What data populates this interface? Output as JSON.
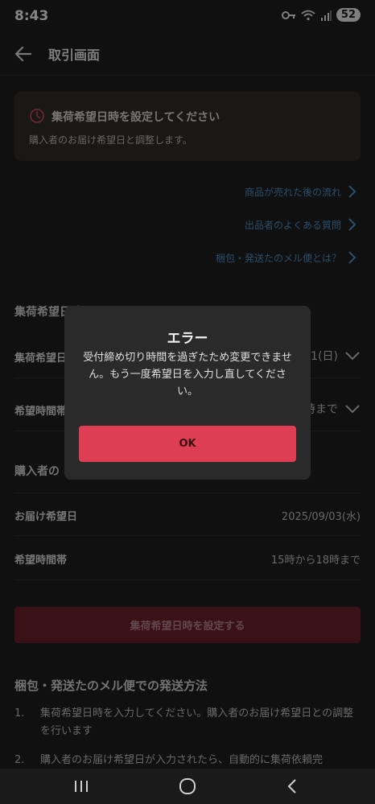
{
  "status_bar": {
    "time": "8:43",
    "battery": "52"
  },
  "header": {
    "title": "取引画面"
  },
  "notice": {
    "title": "集荷希望日時を設定してください",
    "subtitle": "購入者のお届け希望日と調整します。"
  },
  "help_links": [
    {
      "label": "商品が売れた後の流れ"
    },
    {
      "label": "出品者のよくある質問"
    },
    {
      "label": "梱包・発送たのメル便とは？"
    }
  ],
  "pickup_section": {
    "title": "集荷希望日時",
    "date_label": "集荷希望日",
    "date_value": "1(日)",
    "time_label": "希望時間帯",
    "time_value": "時まで"
  },
  "buyer_section": {
    "title": "購入者の",
    "delivery_date_label": "お届け希望日",
    "delivery_date_value": "2025/09/03(水)",
    "delivery_time_label": "希望時間帯",
    "delivery_time_value": "15時から18時まで"
  },
  "primary_button": {
    "label": "集荷希望日時を設定する"
  },
  "method": {
    "title": "梱包・発送たのメル便での発送方法",
    "steps": [
      {
        "num": "1.",
        "text": "集荷希望日時を入力してください。購入者のお届け希望日との調整を行います"
      },
      {
        "num": "2.",
        "text": "購入者のお届け希望日が入力されたら、自動的に集荷依頼完"
      }
    ]
  },
  "dialog": {
    "title": "エラー",
    "message": "受付締め切り時間を過ぎたため変更できません。もう一度希望日を入力し直してください。",
    "ok_label": "OK"
  },
  "colors": {
    "accent": "#de3e53",
    "link": "#4d8fc4",
    "background": "#1e1e1e"
  }
}
